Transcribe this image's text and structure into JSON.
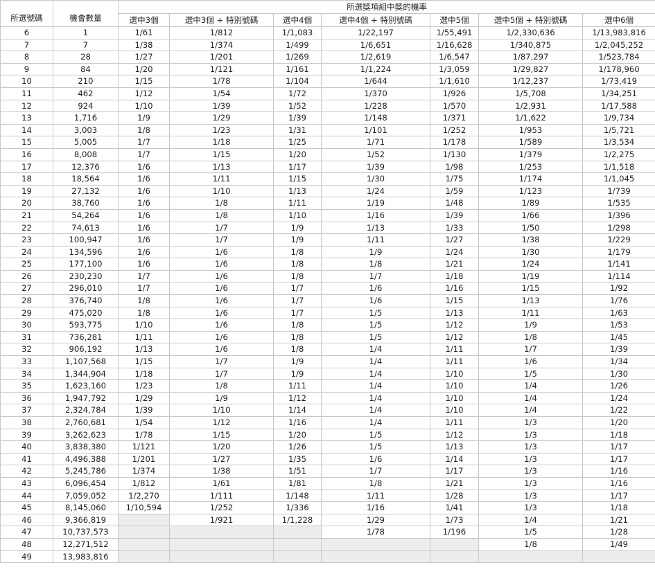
{
  "headers": {
    "picked": "所選號碼",
    "combos": "機會數量",
    "group": "所選獎項組中獎的機率",
    "cols": [
      "選中3個",
      "選中3個 + 特別號碼",
      "選中4個",
      "選中4個 + 特別號碼",
      "選中5個",
      "選中5個 + 特別號碼",
      "選中6個"
    ]
  },
  "rows": [
    [
      "6",
      "1",
      "1/61",
      "1/812",
      "1/1,083",
      "1/22,197",
      "1/55,491",
      "1/2,330,636",
      "1/13,983,816"
    ],
    [
      "7",
      "7",
      "1/38",
      "1/374",
      "1/499",
      "1/6,651",
      "1/16,628",
      "1/340,875",
      "1/2,045,252"
    ],
    [
      "8",
      "28",
      "1/27",
      "1/201",
      "1/269",
      "1/2,619",
      "1/6,547",
      "1/87,297",
      "1/523,784"
    ],
    [
      "9",
      "84",
      "1/20",
      "1/121",
      "1/161",
      "1/1,224",
      "1/3,059",
      "1/29,827",
      "1/178,960"
    ],
    [
      "10",
      "210",
      "1/15",
      "1/78",
      "1/104",
      "1/644",
      "1/1,610",
      "1/12,237",
      "1/73,419"
    ],
    [
      "11",
      "462",
      "1/12",
      "1/54",
      "1/72",
      "1/370",
      "1/926",
      "1/5,708",
      "1/34,251"
    ],
    [
      "12",
      "924",
      "1/10",
      "1/39",
      "1/52",
      "1/228",
      "1/570",
      "1/2,931",
      "1/17,588"
    ],
    [
      "13",
      "1,716",
      "1/9",
      "1/29",
      "1/39",
      "1/148",
      "1/371",
      "1/1,622",
      "1/9,734"
    ],
    [
      "14",
      "3,003",
      "1/8",
      "1/23",
      "1/31",
      "1/101",
      "1/252",
      "1/953",
      "1/5,721"
    ],
    [
      "15",
      "5,005",
      "1/7",
      "1/18",
      "1/25",
      "1/71",
      "1/178",
      "1/589",
      "1/3,534"
    ],
    [
      "16",
      "8,008",
      "1/7",
      "1/15",
      "1/20",
      "1/52",
      "1/130",
      "1/379",
      "1/2,275"
    ],
    [
      "17",
      "12,376",
      "1/6",
      "1/13",
      "1/17",
      "1/39",
      "1/98",
      "1/253",
      "1/1,518"
    ],
    [
      "18",
      "18,564",
      "1/6",
      "1/11",
      "1/15",
      "1/30",
      "1/75",
      "1/174",
      "1/1,045"
    ],
    [
      "19",
      "27,132",
      "1/6",
      "1/10",
      "1/13",
      "1/24",
      "1/59",
      "1/123",
      "1/739"
    ],
    [
      "20",
      "38,760",
      "1/6",
      "1/8",
      "1/11",
      "1/19",
      "1/48",
      "1/89",
      "1/535"
    ],
    [
      "21",
      "54,264",
      "1/6",
      "1/8",
      "1/10",
      "1/16",
      "1/39",
      "1/66",
      "1/396"
    ],
    [
      "22",
      "74,613",
      "1/6",
      "1/7",
      "1/9",
      "1/13",
      "1/33",
      "1/50",
      "1/298"
    ],
    [
      "23",
      "100,947",
      "1/6",
      "1/7",
      "1/9",
      "1/11",
      "1/27",
      "1/38",
      "1/229"
    ],
    [
      "24",
      "134,596",
      "1/6",
      "1/6",
      "1/8",
      "1/9",
      "1/24",
      "1/30",
      "1/179"
    ],
    [
      "25",
      "177,100",
      "1/6",
      "1/6",
      "1/8",
      "1/8",
      "1/21",
      "1/24",
      "1/141"
    ],
    [
      "26",
      "230,230",
      "1/7",
      "1/6",
      "1/8",
      "1/7",
      "1/18",
      "1/19",
      "1/114"
    ],
    [
      "27",
      "296,010",
      "1/7",
      "1/6",
      "1/7",
      "1/6",
      "1/16",
      "1/15",
      "1/92"
    ],
    [
      "28",
      "376,740",
      "1/8",
      "1/6",
      "1/7",
      "1/6",
      "1/15",
      "1/13",
      "1/76"
    ],
    [
      "29",
      "475,020",
      "1/8",
      "1/6",
      "1/7",
      "1/5",
      "1/13",
      "1/11",
      "1/63"
    ],
    [
      "30",
      "593,775",
      "1/10",
      "1/6",
      "1/8",
      "1/5",
      "1/12",
      "1/9",
      "1/53"
    ],
    [
      "31",
      "736,281",
      "1/11",
      "1/6",
      "1/8",
      "1/5",
      "1/12",
      "1/8",
      "1/45"
    ],
    [
      "32",
      "906,192",
      "1/13",
      "1/6",
      "1/8",
      "1/4",
      "1/11",
      "1/7",
      "1/39"
    ],
    [
      "33",
      "1,107,568",
      "1/15",
      "1/7",
      "1/9",
      "1/4",
      "1/11",
      "1/6",
      "1/34"
    ],
    [
      "34",
      "1,344,904",
      "1/18",
      "1/7",
      "1/9",
      "1/4",
      "1/10",
      "1/5",
      "1/30"
    ],
    [
      "35",
      "1,623,160",
      "1/23",
      "1/8",
      "1/11",
      "1/4",
      "1/10",
      "1/4",
      "1/26"
    ],
    [
      "36",
      "1,947,792",
      "1/29",
      "1/9",
      "1/12",
      "1/4",
      "1/10",
      "1/4",
      "1/24"
    ],
    [
      "37",
      "2,324,784",
      "1/39",
      "1/10",
      "1/14",
      "1/4",
      "1/10",
      "1/4",
      "1/22"
    ],
    [
      "38",
      "2,760,681",
      "1/54",
      "1/12",
      "1/16",
      "1/4",
      "1/11",
      "1/3",
      "1/20"
    ],
    [
      "39",
      "3,262,623",
      "1/78",
      "1/15",
      "1/20",
      "1/5",
      "1/12",
      "1/3",
      "1/18"
    ],
    [
      "40",
      "3,838,380",
      "1/121",
      "1/20",
      "1/26",
      "1/5",
      "1/13",
      "1/3",
      "1/17"
    ],
    [
      "41",
      "4,496,388",
      "1/201",
      "1/27",
      "1/35",
      "1/6",
      "1/14",
      "1/3",
      "1/17"
    ],
    [
      "42",
      "5,245,786",
      "1/374",
      "1/38",
      "1/51",
      "1/7",
      "1/17",
      "1/3",
      "1/16"
    ],
    [
      "43",
      "6,096,454",
      "1/812",
      "1/61",
      "1/81",
      "1/8",
      "1/21",
      "1/3",
      "1/16"
    ],
    [
      "44",
      "7,059,052",
      "1/2,270",
      "1/111",
      "1/148",
      "1/11",
      "1/28",
      "1/3",
      "1/17"
    ],
    [
      "45",
      "8,145,060",
      "1/10,594",
      "1/252",
      "1/336",
      "1/16",
      "1/41",
      "1/3",
      "1/18"
    ],
    [
      "46",
      "9,366,819",
      "",
      "1/921",
      "1/1,228",
      "1/29",
      "1/73",
      "1/4",
      "1/21"
    ],
    [
      "47",
      "10,737,573",
      "",
      "",
      "",
      "1/78",
      "1/196",
      "1/5",
      "1/28"
    ],
    [
      "48",
      "12,271,512",
      "",
      "",
      "",
      "",
      "",
      "1/8",
      "1/49"
    ],
    [
      "49",
      "13,983,816",
      "",
      "",
      "",
      "",
      "",
      "",
      ""
    ]
  ]
}
